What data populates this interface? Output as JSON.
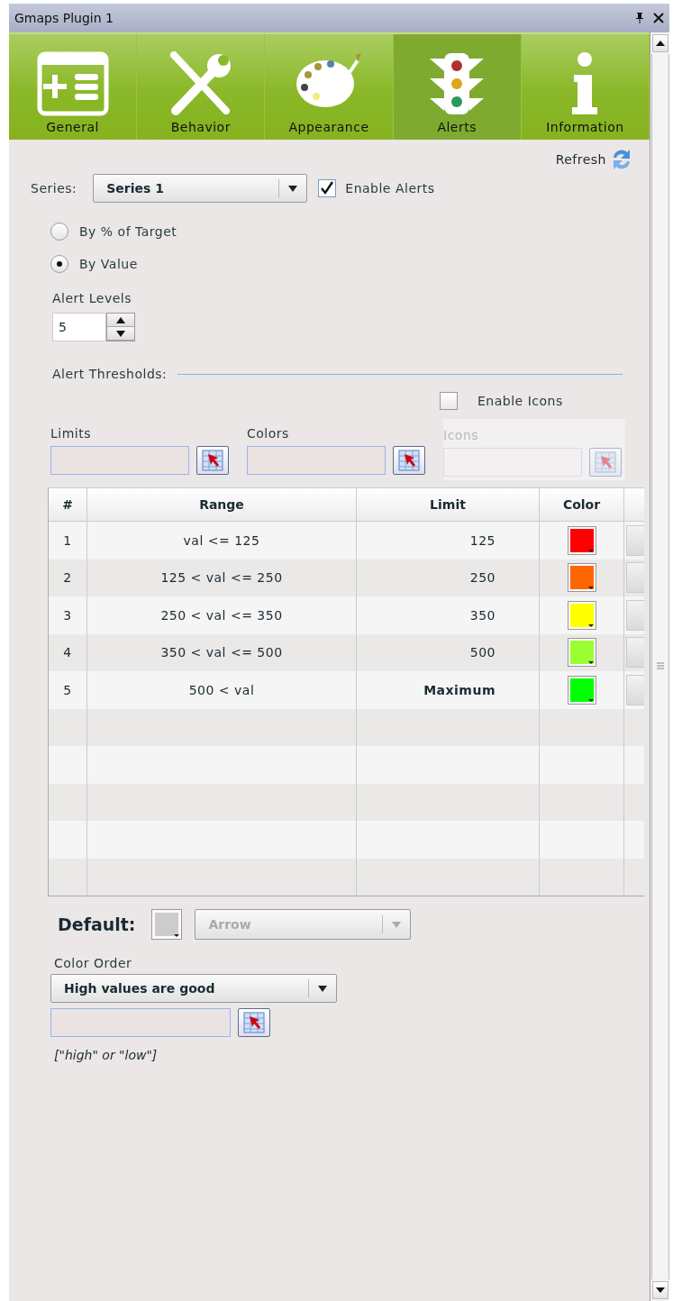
{
  "window": {
    "title": "Gmaps Plugin 1"
  },
  "tabs": [
    {
      "label": "General",
      "selected": false
    },
    {
      "label": "Behavior",
      "selected": false
    },
    {
      "label": "Appearance",
      "selected": false
    },
    {
      "label": "Alerts",
      "selected": true
    },
    {
      "label": "Information",
      "selected": false
    }
  ],
  "refresh": {
    "label": "Refresh"
  },
  "series": {
    "label": "Series:",
    "value": "Series 1"
  },
  "enable_alerts": {
    "label": "Enable Alerts",
    "checked": true
  },
  "modes": [
    {
      "label": "By % of Target",
      "selected": false
    },
    {
      "label": "By Value",
      "selected": true
    }
  ],
  "alert_levels": {
    "label": "Alert Levels",
    "value": "5"
  },
  "alert_thresholds": {
    "label": "Alert Thresholds:"
  },
  "enable_icons": {
    "label": "Enable Icons",
    "checked": false
  },
  "pickers": [
    {
      "label": "Limits",
      "disabled": false
    },
    {
      "label": "Colors",
      "disabled": false
    },
    {
      "label": "Icons",
      "disabled": true
    }
  ],
  "table": {
    "columns": [
      "#",
      "Range",
      "Limit",
      "Color"
    ],
    "rows": [
      {
        "index": "1",
        "range": "val <= 125",
        "limit": "125",
        "bold": false,
        "color": "#ff0000"
      },
      {
        "index": "2",
        "range": "125 < val <= 250",
        "limit": "250",
        "bold": false,
        "color": "#ff6600"
      },
      {
        "index": "3",
        "range": "250 < val <= 350",
        "limit": "350",
        "bold": false,
        "color": "#ffff00"
      },
      {
        "index": "4",
        "range": "350 < val <= 500",
        "limit": "500",
        "bold": false,
        "color": "#99ff33"
      },
      {
        "index": "5",
        "range": "500 < val",
        "limit": "Maximum",
        "bold": true,
        "color": "#00ff00"
      }
    ]
  },
  "default": {
    "label": "Default:",
    "color": "#cccccc",
    "icon_value": "Arrow",
    "disabled": true
  },
  "color_order": {
    "label": "Color Order",
    "value": "High values are good",
    "hint": "[\"high\" or \"low\"]"
  }
}
